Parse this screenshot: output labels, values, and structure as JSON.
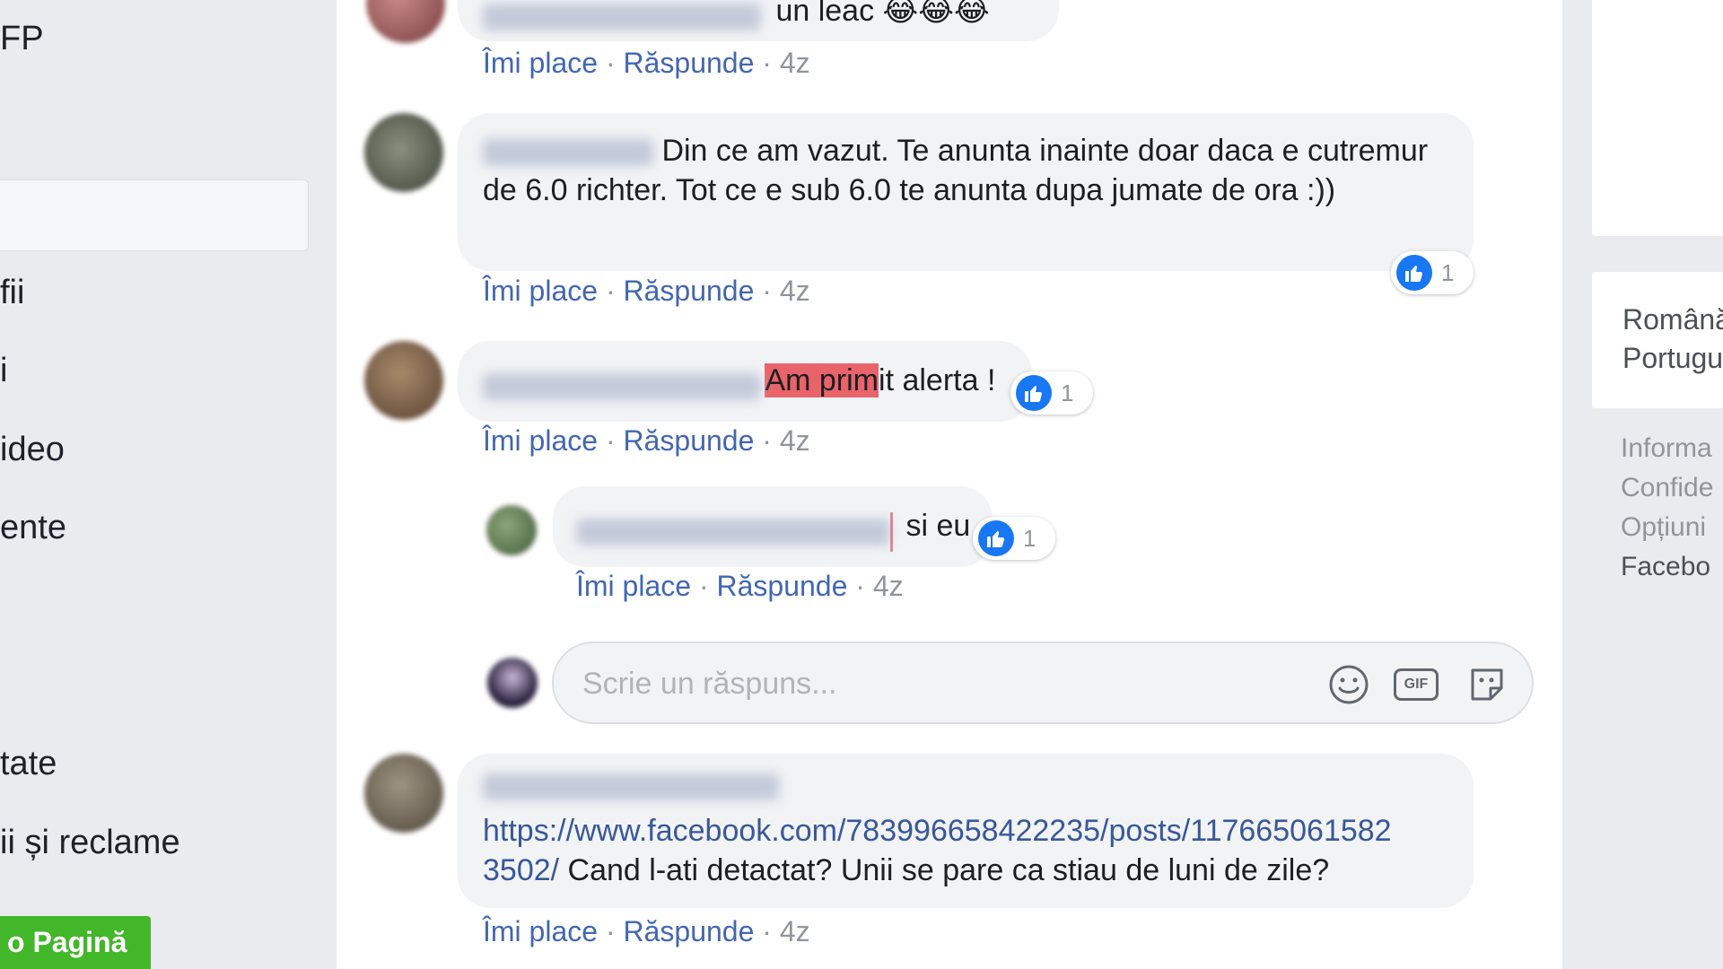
{
  "left_sidebar": {
    "items": [
      "FP",
      "fii",
      "i",
      "ideo",
      "ente",
      "tate",
      "ii și reclame"
    ],
    "create_page_label": "o Pagină"
  },
  "comments": [
    {
      "text_tail": "un leac 😂😂😂",
      "actions": {
        "like": "Îmi place",
        "reply": "Răspunde",
        "time": "4z"
      }
    },
    {
      "text": "Din ce am vazut. Te anunta inainte doar daca e cutremur de 6.0 richter. Tot ce e sub 6.0 te anunta dupa jumate de ora :))",
      "reaction_count": "1",
      "actions": {
        "like": "Îmi place",
        "reply": "Răspunde",
        "time": "4z"
      }
    },
    {
      "text_highlight": "Am prim",
      "text_rest": "it alerta !",
      "reaction_count": "1",
      "actions": {
        "like": "Îmi place",
        "reply": "Răspunde",
        "time": "4z"
      }
    },
    {
      "text": "si eu",
      "reaction_count": "1",
      "actions": {
        "like": "Îmi place",
        "reply": "Răspunde",
        "time": "4z"
      }
    },
    {
      "link_text": "https://www.facebook.com/783996658422235/posts/117665061582 3502/",
      "text": "Cand l-ati detactat? Unii se pare ca stiau de luni de zile?",
      "actions": {
        "like": "Îmi place",
        "reply": "Răspunde",
        "time": "4z"
      }
    }
  ],
  "reply_box": {
    "placeholder": "Scrie un răspuns...",
    "gif_label": "GIF",
    "icons": [
      "emoji-icon",
      "gif-icon",
      "sticker-icon"
    ]
  },
  "right_column": {
    "languages": [
      "Română",
      "Portugu"
    ],
    "footer_links": [
      "Informa",
      "Confide",
      "Opțiuni",
      "Facebo"
    ]
  },
  "colors": {
    "link": "#4267b2",
    "like_blue": "#1877f2",
    "create_page_green": "#42b72a",
    "highlight": "#e8646a"
  }
}
